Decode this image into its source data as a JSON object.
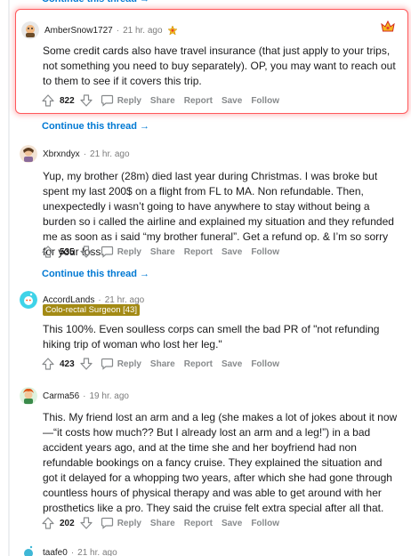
{
  "continue_label": "Continue this thread",
  "comments": [
    {
      "author": "AmberSnow1727",
      "time": "21 hr. ago",
      "body": "Some credit cards also have travel insurance (that just apply to your trips, not something you need to buy separately). OP, you may want to reach out to them to see if it covers this trip.",
      "score": "822",
      "award_icon": "award-icon"
    },
    {
      "author": "Xbrxndyx",
      "time": "21 hr. ago",
      "body": "Yup, my brother (28m) died last year during Christmas. I was broke but spent my last 200$ on a flight from FL to MA. Non refundable. Then, unexpectedly i wasn’t going to have anywhere to stay without being a burden so i called the airline and explained my situation and they refunded me as soon as i said “my brother funeral”. Get a refund op. & I’m so sorry for your loss.",
      "score": "535"
    },
    {
      "author": "AccordLands",
      "time": "21 hr. ago",
      "flair": "Colo-rectal Surgeon [43]",
      "body": "This 100%. Even soulless corps can smell the bad PR of \"not refunding hiking trip of woman who lost her leg.\"",
      "score": "423"
    },
    {
      "author": "Carma56",
      "time": "19 hr. ago",
      "body": "This. My friend lost an arm and a leg (she makes a lot of jokes about it now—“it costs how much?? But I already lost an arm and a leg!”) in a bad accident years ago, and at the time she and her boyfriend had non refundable bookings on a fancy cruise. They explained the situation and got it delayed for a whopping two years, after which she had gone through countless hours of physical therapy and was able to get around with her prosthetics like a pro. They said the cruise felt extra special after all that.",
      "score": "202"
    },
    {
      "author": "taafe0",
      "time": "21 hr. ago"
    }
  ],
  "actions": {
    "reply": "Reply",
    "share": "Share",
    "report": "Report",
    "save": "Save",
    "follow": "Follow"
  },
  "colors": {
    "highlight_border": "#ff585b",
    "link_blue": "#0079d3",
    "flair_bg": "#a38a15"
  }
}
